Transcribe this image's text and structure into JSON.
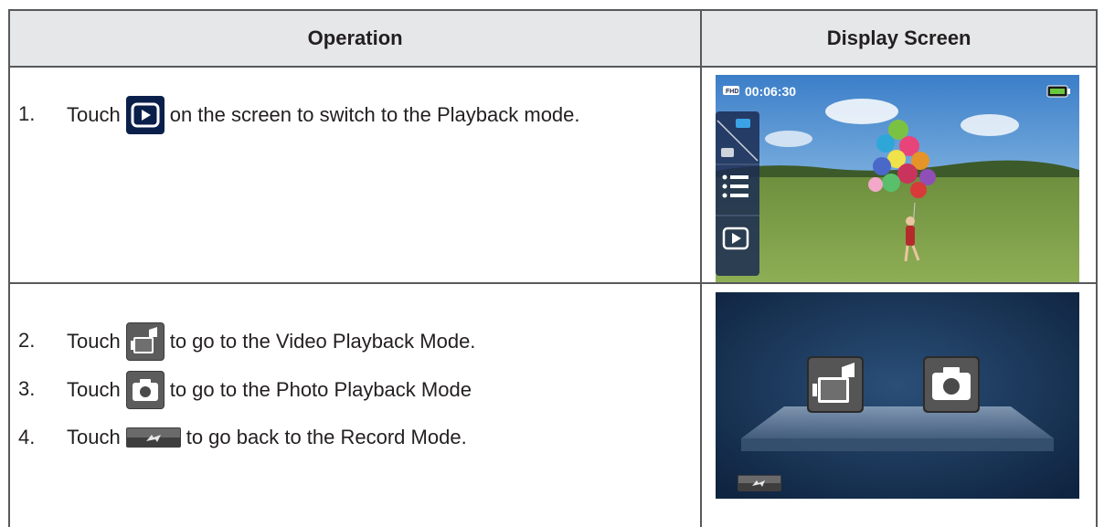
{
  "table": {
    "headers": [
      "Operation",
      "Display Screen"
    ],
    "rows": [
      {
        "steps": [
          {
            "num": "1.",
            "pre": "Touch",
            "icon": "playback-icon",
            "post": "on the screen to switch to the Playback mode."
          }
        ],
        "screen": {
          "timer": "00:06:30",
          "badge": "FHD"
        }
      },
      {
        "steps": [
          {
            "num": "2.",
            "pre": "Touch",
            "icon": "video-camera-icon",
            "post": "to go to the Video Playback Mode."
          },
          {
            "num": "3.",
            "pre": "Touch",
            "icon": "photo-camera-icon",
            "post": "to go to the Photo Playback Mode"
          },
          {
            "num": "4.",
            "pre": "Touch",
            "icon": "back-arrow-icon",
            "post": "to go back to the Record Mode."
          }
        ]
      }
    ]
  }
}
